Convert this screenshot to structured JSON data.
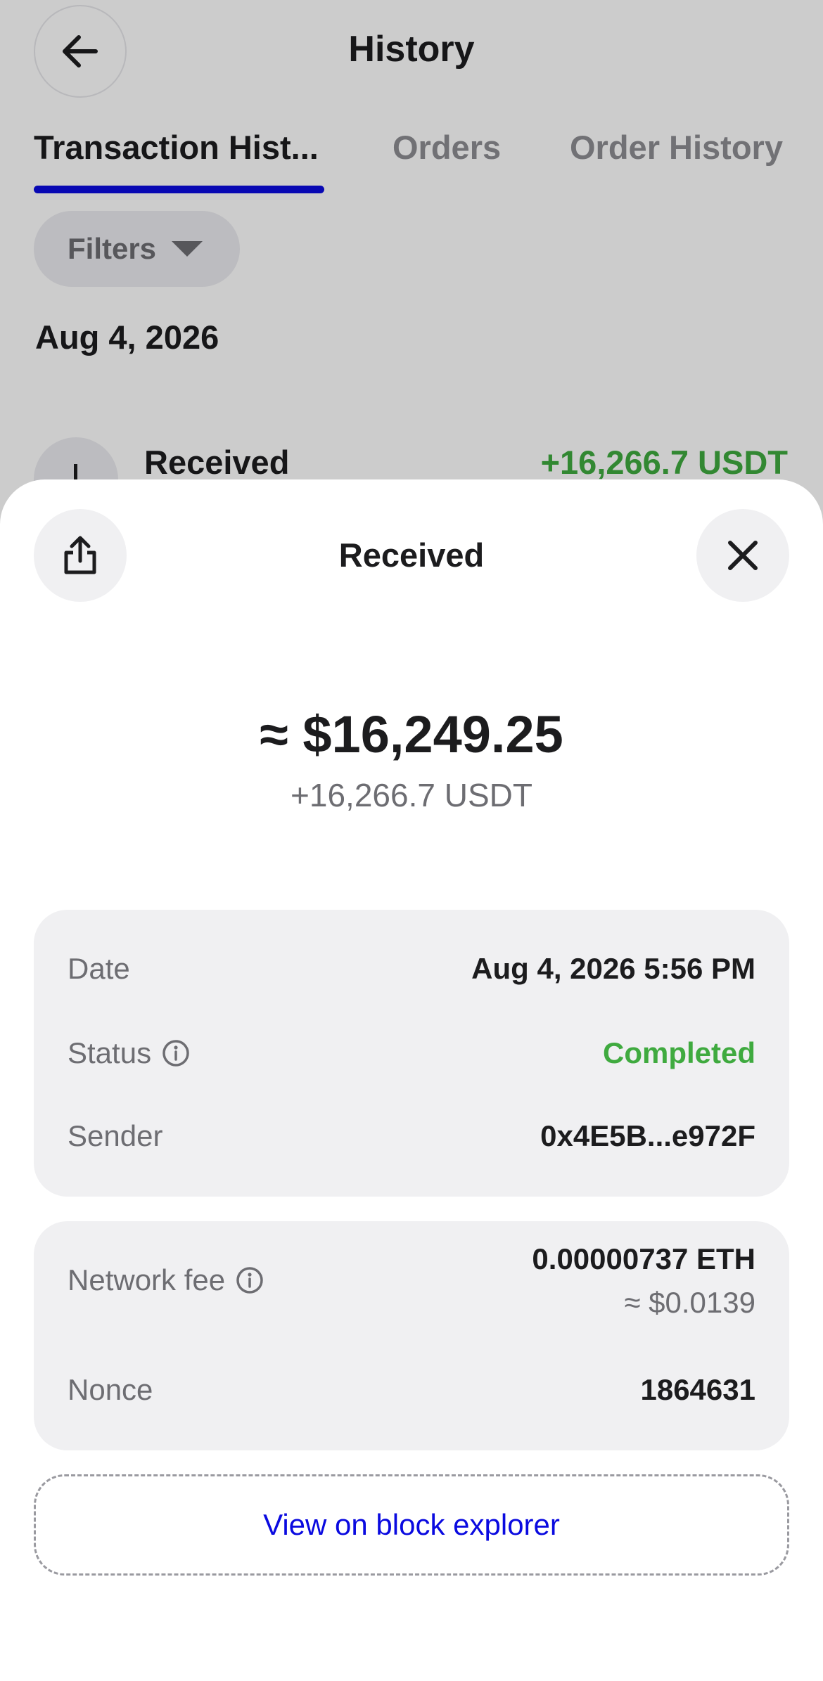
{
  "header": {
    "title": "History"
  },
  "tabs": [
    {
      "label": "Transaction Hist..."
    },
    {
      "label": "Orders"
    },
    {
      "label": "Order History"
    }
  ],
  "filters": {
    "label": "Filters"
  },
  "list": {
    "date_heading": "Aug 4, 2026",
    "rows": [
      {
        "label": "Received",
        "amount": "+16,266.7 USDT"
      }
    ]
  },
  "sheet": {
    "title": "Received",
    "fiat_amount": "≈ $16,249.25",
    "crypto_amount": "+16,266.7 USDT",
    "details": {
      "date_label": "Date",
      "date_value": "Aug 4, 2026 5:56 PM",
      "status_label": "Status",
      "status_value": "Completed",
      "sender_label": "Sender",
      "sender_value": "0x4E5B...e972F"
    },
    "fees": {
      "network_fee_label": "Network fee",
      "network_fee_value": "0.00000737 ETH",
      "network_fee_fiat": "≈ $0.0139",
      "nonce_label": "Nonce",
      "nonce_value": "1864631"
    },
    "explorer_link": "View on block explorer"
  },
  "colors": {
    "accent": "#0a0ae0",
    "positive": "#3faa3f",
    "text_primary": "#1c1c1e",
    "text_secondary": "#6d6d72",
    "card_bg": "#f0f0f2"
  },
  "icons": [
    "back-arrow-icon",
    "chevron-down-icon",
    "receive-icon",
    "share-icon",
    "close-icon",
    "info-icon"
  ]
}
